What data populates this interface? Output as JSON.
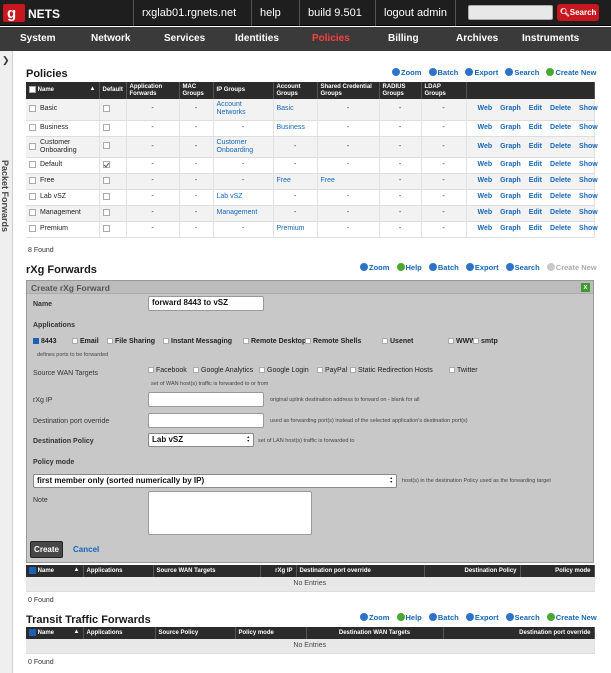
{
  "topbar": {
    "logo_text": "NETS",
    "host": "rxglab01.rgnets.net",
    "help": "help",
    "build": "build 9.501",
    "logout": "logout admin",
    "search_label": "Search"
  },
  "nav": [
    "System",
    "Network",
    "Services",
    "Identities",
    "Policies",
    "Billing",
    "Archives",
    "Instruments"
  ],
  "sidebar": {
    "label": "Packet Forwards"
  },
  "policies": {
    "title": "Policies",
    "actions": [
      "Zoom",
      "Batch",
      "Export",
      "Search",
      "Create New"
    ],
    "columns": [
      "Name",
      "Default",
      "Application Forwards",
      "MAC Groups",
      "IP Groups",
      "Account Groups",
      "Shared Credential Groups",
      "RADIUS Groups",
      "LDAP Groups"
    ],
    "rows": [
      {
        "name": "Basic",
        "default": "",
        "app": "-",
        "mac": "-",
        "ip": "Account Networks",
        "acct": "Basic",
        "shared": "-",
        "radius": "-",
        "ldap": "-"
      },
      {
        "name": "Business",
        "default": "",
        "app": "-",
        "mac": "-",
        "ip": "-",
        "acct": "Business",
        "shared": "-",
        "radius": "-",
        "ldap": "-"
      },
      {
        "name": "Customer Onboarding",
        "default": "",
        "app": "-",
        "mac": "-",
        "ip": "Customer Onboarding",
        "acct": "-",
        "shared": "-",
        "radius": "-",
        "ldap": "-"
      },
      {
        "name": "Default",
        "default": "check",
        "app": "-",
        "mac": "-",
        "ip": "-",
        "acct": "-",
        "shared": "-",
        "radius": "-",
        "ldap": "-"
      },
      {
        "name": "Free",
        "default": "",
        "app": "-",
        "mac": "-",
        "ip": "-",
        "acct": "Free",
        "shared": "Free",
        "radius": "-",
        "ldap": "-"
      },
      {
        "name": "Lab vSZ",
        "default": "",
        "app": "-",
        "mac": "-",
        "ip": "Lab vSZ",
        "acct": "-",
        "shared": "-",
        "radius": "-",
        "ldap": "-"
      },
      {
        "name": "Management",
        "default": "",
        "app": "-",
        "mac": "-",
        "ip": "Management",
        "acct": "-",
        "shared": "-",
        "radius": "-",
        "ldap": "-"
      },
      {
        "name": "Premium",
        "default": "",
        "app": "-",
        "mac": "-",
        "ip": "-",
        "acct": "Premium",
        "shared": "-",
        "radius": "-",
        "ldap": "-"
      }
    ],
    "row_ops": [
      "Web",
      "Graph",
      "Edit",
      "Delete",
      "Show"
    ],
    "found": "8 Found"
  },
  "forwards": {
    "title": "rXg Forwards",
    "actions": [
      "Zoom",
      "Help",
      "Batch",
      "Export",
      "Search",
      "Create New"
    ],
    "form": {
      "header": "Create rXg Forward",
      "name_label": "Name",
      "name_value": "forward 8443 to vSZ",
      "applications_label": "Applications",
      "applications": [
        "8443",
        "Email",
        "File Sharing",
        "Instant Messaging",
        "Remote Desktop",
        "Remote Shells",
        "Usenet",
        "WWW",
        "smtp"
      ],
      "applications_hint": "defines ports to be forwarded",
      "source_wan_label": "Source WAN Targets",
      "source_wan": [
        "Facebook",
        "Google Analytics",
        "Google Login",
        "PayPal",
        "Static Redirection Hosts",
        "Twitter"
      ],
      "source_wan_hint": "set of WAN host(s) traffic is forwarded to or from",
      "rxg_ip_label": "rXg IP",
      "rxg_ip_hint": "original uplink destination address to forward on - blank for all",
      "dest_port_label": "Destination port override",
      "dest_port_hint": "used as forwarding port(s) instead of the selected application's destination port(s)",
      "dest_policy_label": "Destination Policy",
      "dest_policy_value": "Lab vSZ",
      "dest_policy_hint": "set of LAN host(s) traffic is forwarded to",
      "policy_mode_label": "Policy mode",
      "policy_mode_value": "first member only (sorted numerically by IP)",
      "policy_mode_hint": "host(s) in the destination Policy used as the forwarding target",
      "note_label": "Note",
      "create": "Create",
      "cancel": "Cancel"
    },
    "columns": [
      "Name",
      "Applications",
      "Source WAN Targets",
      "rXg IP",
      "Destination port override",
      "Destination Policy",
      "Policy mode"
    ],
    "empty": "No Entries",
    "found": "0 Found"
  },
  "transit": {
    "title": "Transit Traffic Forwards",
    "actions": [
      "Zoom",
      "Help",
      "Batch",
      "Export",
      "Search",
      "Create New"
    ],
    "columns": [
      "Name",
      "Applications",
      "Source Policy",
      "Policy mode",
      "Destination WAN Targets",
      "Destination port override"
    ],
    "empty": "No Entries",
    "found": "0 Found"
  }
}
